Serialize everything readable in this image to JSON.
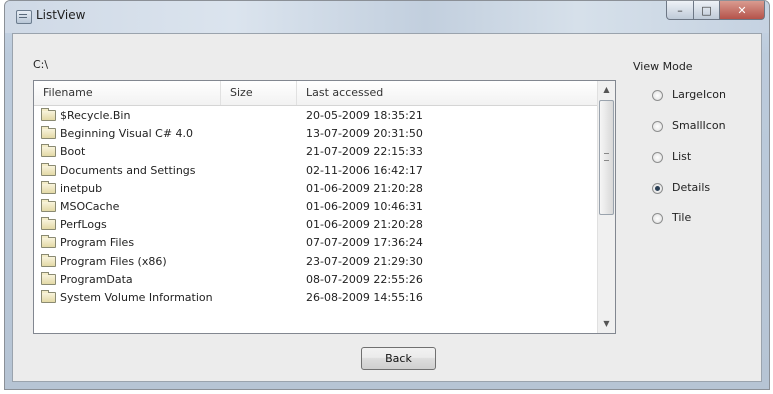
{
  "window": {
    "title": "ListView",
    "caption_min": "–",
    "caption_max": "□",
    "caption_close": "✕"
  },
  "path": "C:\\",
  "list": {
    "columns": [
      "Filename",
      "Size",
      "Last accessed"
    ],
    "rows": [
      {
        "name": "$Recycle.Bin",
        "size": "",
        "accessed": "20-05-2009 18:35:21"
      },
      {
        "name": "Beginning Visual C# 4.0",
        "size": "",
        "accessed": "13-07-2009 20:31:50"
      },
      {
        "name": "Boot",
        "size": "",
        "accessed": "21-07-2009 22:15:33"
      },
      {
        "name": "Documents and Settings",
        "size": "",
        "accessed": "02-11-2006 16:42:17"
      },
      {
        "name": "inetpub",
        "size": "",
        "accessed": "01-06-2009 21:20:28"
      },
      {
        "name": "MSOCache",
        "size": "",
        "accessed": "01-06-2009 10:46:31"
      },
      {
        "name": "PerfLogs",
        "size": "",
        "accessed": "01-06-2009 21:20:28"
      },
      {
        "name": "Program Files",
        "size": "",
        "accessed": "07-07-2009 17:36:24"
      },
      {
        "name": "Program Files (x86)",
        "size": "",
        "accessed": "23-07-2009 21:29:30"
      },
      {
        "name": "ProgramData",
        "size": "",
        "accessed": "08-07-2009 22:55:26"
      },
      {
        "name": "System Volume Information",
        "size": "",
        "accessed": "26-08-2009 14:55:16"
      }
    ],
    "scroll_up_glyph": "▲",
    "scroll_down_glyph": "▼"
  },
  "back_button": "Back",
  "view_mode": {
    "label": "View Mode",
    "options": [
      "LargeIcon",
      "SmallIcon",
      "List",
      "Details",
      "Tile"
    ],
    "selected": "Details"
  }
}
